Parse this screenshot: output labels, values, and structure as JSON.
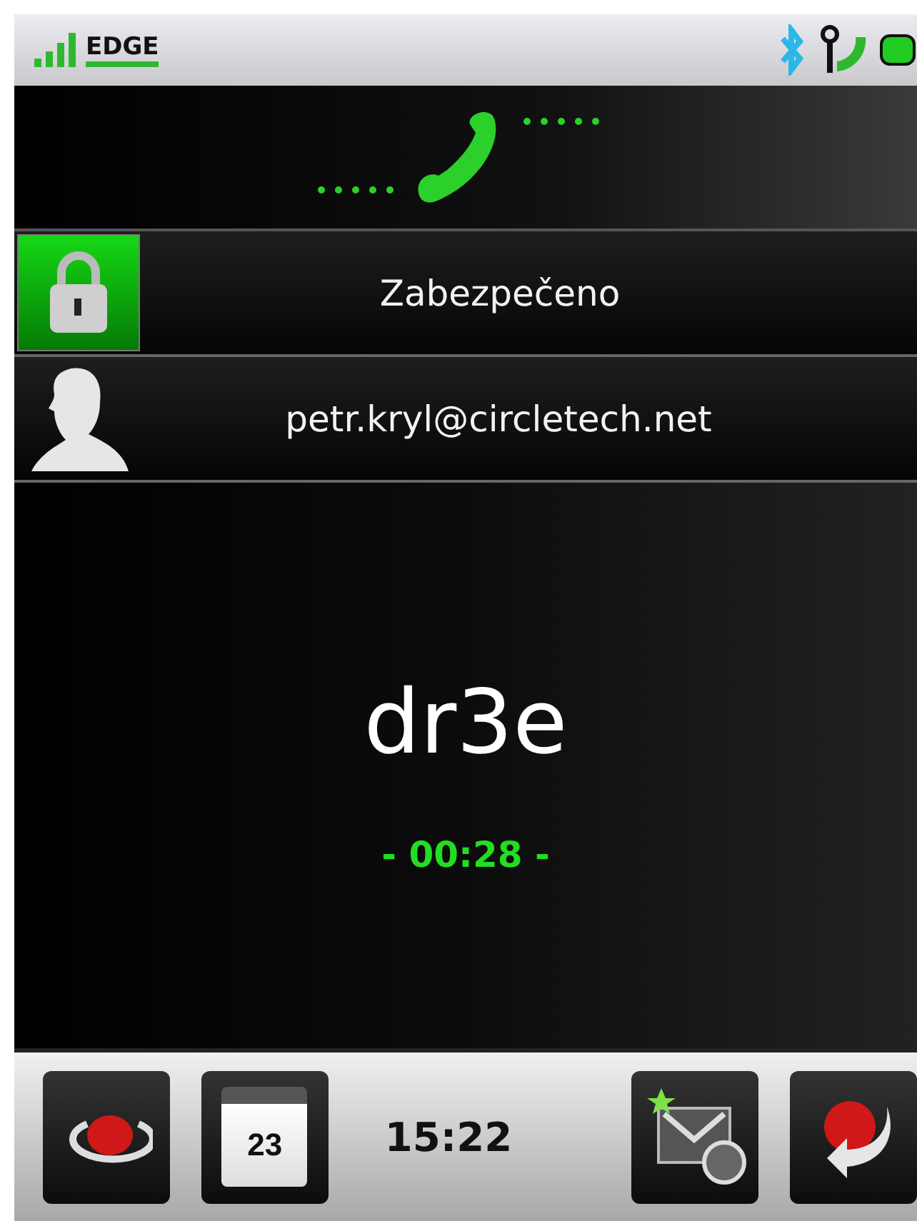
{
  "status_bar": {
    "network": "EDGE"
  },
  "security": {
    "label": "Zabezpečeno",
    "secured": true
  },
  "contact": {
    "address": "petr.kryl@circletech.net"
  },
  "call": {
    "name": "dr3e",
    "duration": "- 00:28 -"
  },
  "bottom_bar": {
    "calendar_day": "23",
    "time": "15:22"
  }
}
